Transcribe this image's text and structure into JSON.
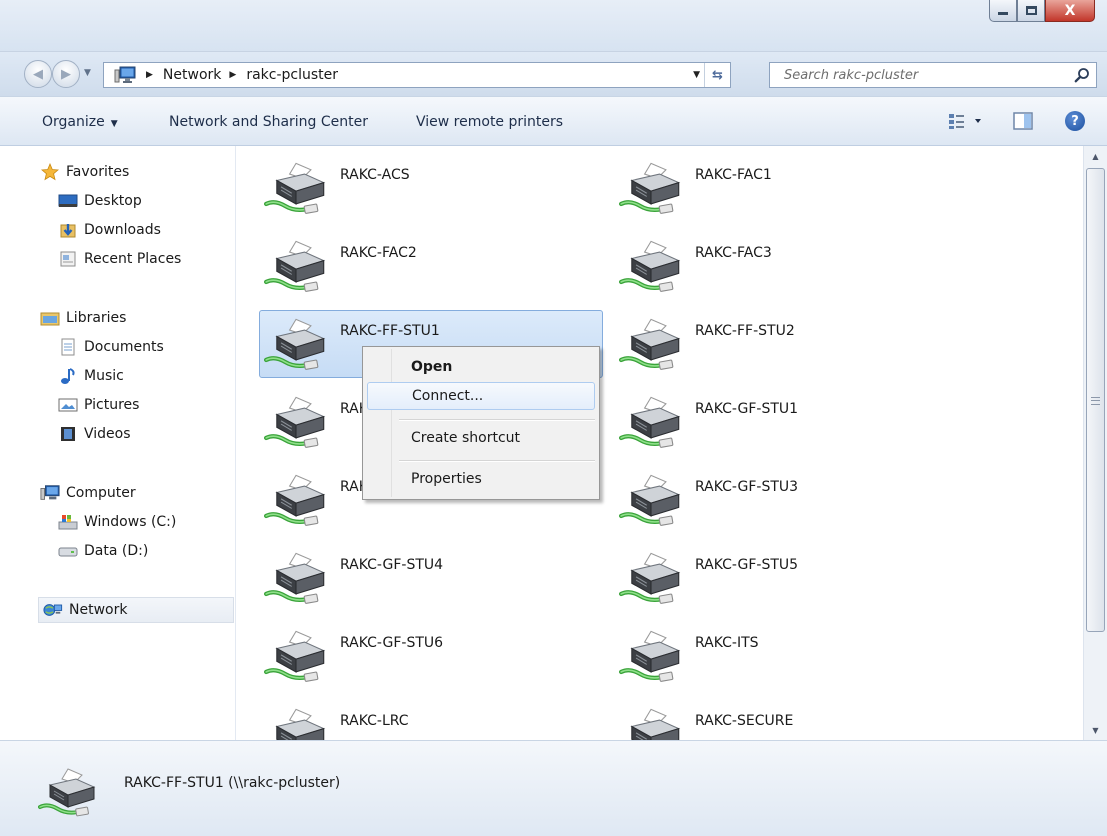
{
  "window": {
    "minimize_label": "",
    "maximize_label": "",
    "close_label": "X"
  },
  "address": {
    "crumbs": [
      "Network",
      "rakc-pcluster"
    ],
    "search_placeholder": "Search rakc-pcluster"
  },
  "toolbar": {
    "organize": "Organize",
    "network_sharing": "Network and Sharing Center",
    "view_remote_printers": "View remote printers"
  },
  "sidebar": {
    "favorites": "Favorites",
    "desktop": "Desktop",
    "downloads": "Downloads",
    "recent_places": "Recent Places",
    "libraries": "Libraries",
    "documents": "Documents",
    "music": "Music",
    "pictures": "Pictures",
    "videos": "Videos",
    "computer": "Computer",
    "windows_c": "Windows (C:)",
    "data_d": "Data (D:)",
    "network": "Network"
  },
  "printers": [
    "RAKC-ACS",
    "RAKC-FAC1",
    "RAKC-FAC2",
    "RAKC-FAC3",
    "RAKC-FF-STU1",
    "RAKC-FF-STU2",
    "RAKC-GF-STU1",
    "RAKC-GF-STU1",
    "RAKC-GF-STU2",
    "RAKC-GF-STU3",
    "RAKC-GF-STU4",
    "RAKC-GF-STU5",
    "RAKC-GF-STU6",
    "RAKC-ITS",
    "RAKC-LRC",
    "RAKC-SECURE"
  ],
  "context_menu": {
    "open": "Open",
    "connect": "Connect...",
    "create_shortcut": "Create shortcut",
    "properties": "Properties"
  },
  "details": {
    "name": "RAKC-FF-STU1 (\\\\rakc-pcluster)"
  },
  "colors": {
    "selection": "#c6dcf5",
    "selection_border": "#84acdd",
    "chrome": "#dfe9f5"
  }
}
